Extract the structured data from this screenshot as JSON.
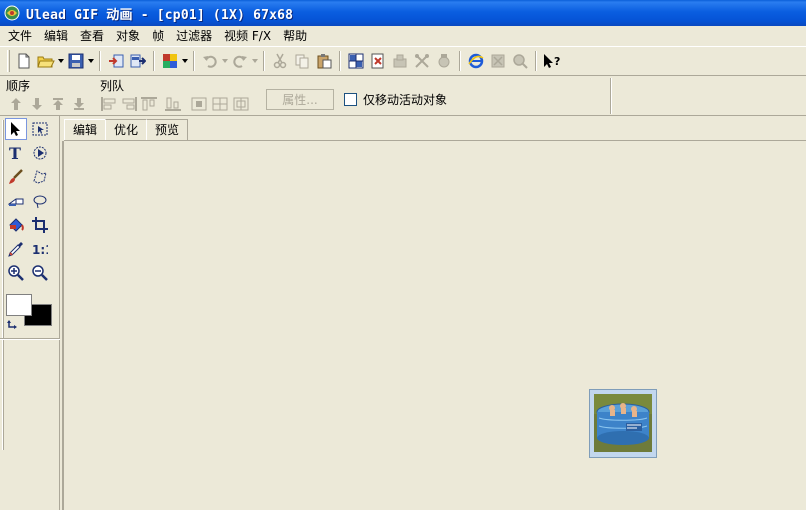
{
  "window": {
    "title": "Ulead GIF 动画 - [cp01] (1X) 67x68"
  },
  "menu": [
    "文件",
    "编辑",
    "查看",
    "对象",
    "帧",
    "过滤器",
    "视频 F/X",
    "帮助"
  ],
  "object_bar": {
    "order_label": "顺序",
    "queue_label": "列队",
    "properties_button": "属性...",
    "move_active_only_label": "仅移动活动对象",
    "move_active_only_checked": false
  },
  "tabs": [
    "编辑",
    "优化",
    "预览"
  ],
  "colors": {
    "title_bar": "#0a5ee0",
    "foreground_color": "#ffffff",
    "background_color": "#000000"
  },
  "icons": {
    "toolbar": [
      "new-file-icon",
      "open-folder-icon",
      "save-icon",
      "import-icon",
      "export-frames-icon",
      "color-palette-icon",
      "undo-icon",
      "redo-icon",
      "cut-icon",
      "copy-icon",
      "paste-icon",
      "frame-grid-icon",
      "tween-icon",
      "stamp-icon",
      "crop-icon",
      "refresh-icon",
      "ie-preview-icon",
      "disabled-icon",
      "zoom-icon",
      "help-cursor-icon"
    ],
    "tools": [
      "pick-arrow-icon",
      "marquee-icon",
      "text-icon",
      "transform-icon",
      "paintbrush-icon",
      "lasso-icon",
      "eraser-icon",
      "oval-lasso-icon",
      "fill-bucket-icon",
      "crop-tool-icon",
      "eyedropper-icon",
      "actual-size-icon",
      "zoom-in-icon",
      "zoom-out-icon"
    ]
  }
}
